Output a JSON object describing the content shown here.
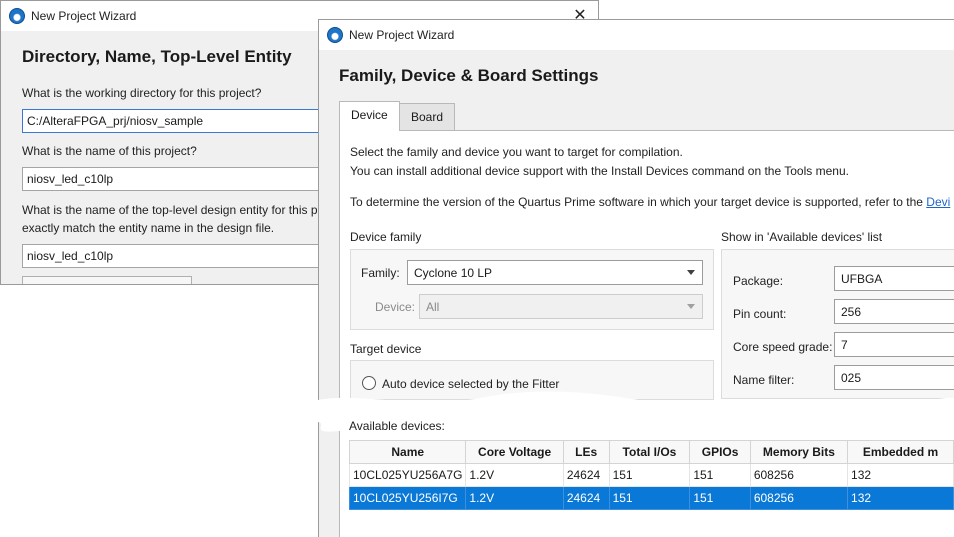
{
  "back_window": {
    "title": "New Project Wizard",
    "close_glyph": "✕",
    "heading": "Directory, Name, Top-Level Entity",
    "q_directory": "What is the working directory for this project?",
    "directory_value": "C:/AlteraFPGA_prj/niosv_sample",
    "q_name": "What is the name of this project?",
    "name_value": "niosv_led_c10lp",
    "q_top_line1": "What is the name of the top-level design entity for this p",
    "q_top_line2": "exactly match the entity name in the design file.",
    "top_value": "niosv_led_c10lp"
  },
  "front_window": {
    "title": "New Project Wizard",
    "heading": "Family, Device & Board Settings",
    "tabs": [
      {
        "label": "Device",
        "active": true
      },
      {
        "label": "Board",
        "active": false
      }
    ],
    "intro_line1": "Select the family and device you want to target for compilation.",
    "intro_line2": "You can install additional device support with the Install Devices command on the Tools menu.",
    "version_text": "To determine the version of the Quartus Prime software in which your target device is supported, refer to the ",
    "version_link": "Devi",
    "device_family": {
      "group_label": "Device family",
      "family_label": "Family:",
      "family_value": "Cyclone 10 LP",
      "device_label": "Device:",
      "device_value": "All"
    },
    "target_device": {
      "group_label": "Target device",
      "auto_label": "Auto device selected by the Fitter"
    },
    "filters": {
      "group_label": "Show in 'Available devices' list",
      "package_label": "Package:",
      "package_value": "UFBGA",
      "pin_count_label": "Pin count:",
      "pin_count_value": "256",
      "speed_grade_label": "Core speed grade:",
      "speed_grade_value": "7",
      "name_filter_label": "Name filter:",
      "name_filter_value": "025"
    },
    "available_label": "Available devices:",
    "table": {
      "columns": [
        "Name",
        "Core Voltage",
        "LEs",
        "Total I/Os",
        "GPIOs",
        "Memory Bits",
        "Embedded m"
      ],
      "rows": [
        [
          "10CL025YU256A7G",
          "1.2V",
          "24624",
          "151",
          "151",
          "608256",
          "132"
        ],
        [
          "10CL025YU256I7G",
          "1.2V",
          "24624",
          "151",
          "151",
          "608256",
          "132"
        ]
      ],
      "selected_row": 1
    }
  },
  "colors": {
    "selection": "#0a78d7",
    "link": "#1e64c8",
    "app_icon": "#1e74c6"
  }
}
